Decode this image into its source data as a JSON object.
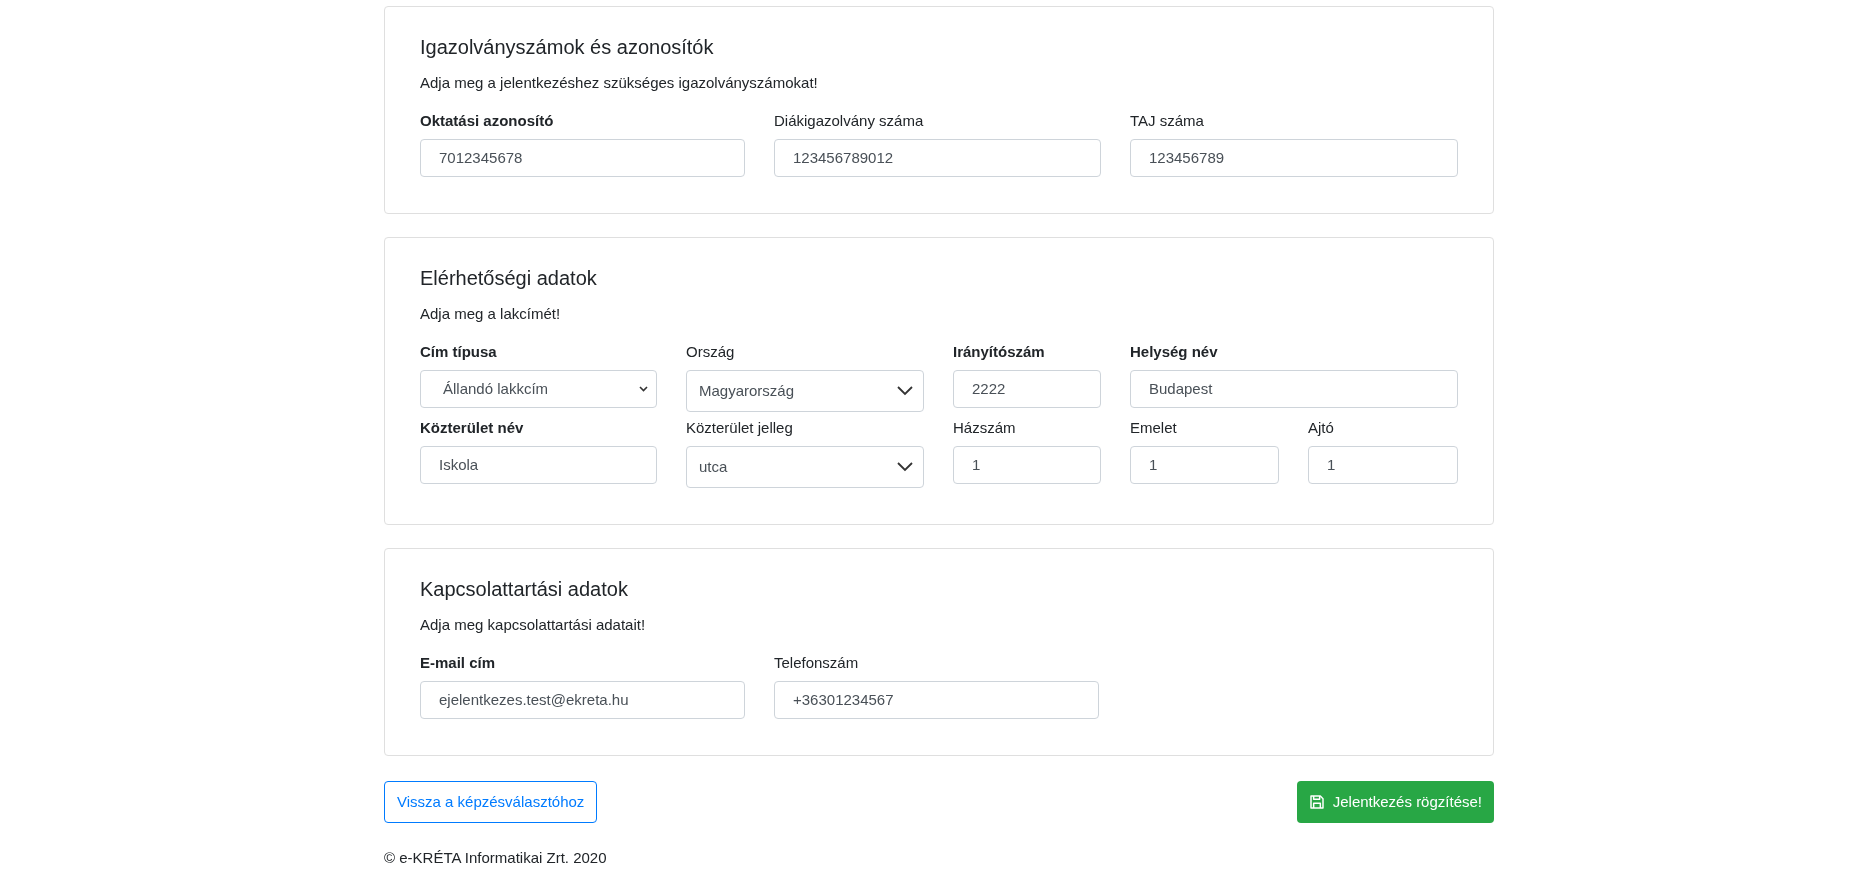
{
  "cards": [
    {
      "title": "Igazolványszámok és azonosítók",
      "subtitle": "Adja meg a jelentkezéshez szükséges igazolványszámokat!",
      "rows": [
        [
          {
            "label": "Oktatási azonosító",
            "required": true,
            "kind": "input",
            "value": "7012345678"
          },
          {
            "label": "Diákigazolvány száma",
            "required": false,
            "kind": "input",
            "value": "123456789012"
          },
          {
            "label": "TAJ száma",
            "required": false,
            "kind": "input",
            "value": "123456789"
          }
        ]
      ]
    },
    {
      "title": "Elérhetőségi adatok",
      "subtitle": "Adja meg a lakcímét!",
      "rows": [
        [
          {
            "label": "Cím típusa",
            "required": true,
            "kind": "native-select",
            "value": "Állandó lakkcím"
          },
          {
            "label": "Ország",
            "required": false,
            "kind": "select",
            "value": "Magyarország"
          },
          {
            "label": "Irányítószám",
            "required": true,
            "kind": "input",
            "value": "2222"
          },
          {
            "label": "Helység név",
            "required": true,
            "kind": "input",
            "value": "Budapest"
          }
        ],
        [
          {
            "label": "Közterület név",
            "required": true,
            "kind": "input",
            "value": "Iskola"
          },
          {
            "label": "Közterület jelleg",
            "required": false,
            "kind": "select",
            "value": "utca"
          },
          {
            "label": "Házszám",
            "required": false,
            "kind": "input",
            "value": "1"
          },
          {
            "label": "Emelet",
            "required": false,
            "kind": "input",
            "value": "1"
          },
          {
            "label": "Ajtó",
            "required": false,
            "kind": "input",
            "value": "1"
          }
        ]
      ]
    },
    {
      "title": "Kapcsolattartási adatok",
      "subtitle": "Adja meg kapcsolattartási adatait!",
      "rows": [
        [
          {
            "label": "E-mail cím",
            "required": true,
            "kind": "input",
            "value": "ejelentkezes.test@ekreta.hu"
          },
          {
            "label": "Telefonszám",
            "required": false,
            "kind": "input",
            "value": "+36301234567"
          }
        ]
      ]
    }
  ],
  "back_button": "Vissza a képzésválasztóhoz",
  "submit_button": "Jelentkezés rögzítése!",
  "footer": "© e-KRÉTA Informatikai Zrt. 2020"
}
